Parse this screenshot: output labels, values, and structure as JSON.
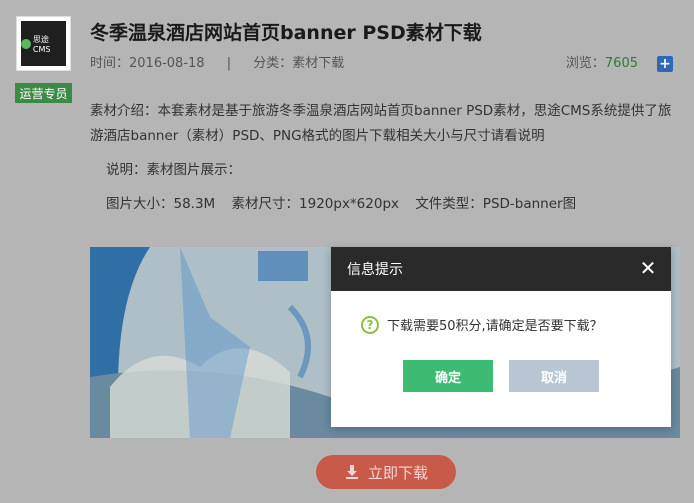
{
  "logo": {
    "text": "思途CMS"
  },
  "badge": {
    "label": "运营专员"
  },
  "article": {
    "title": "冬季温泉酒店网站首页banner PSD素材下载",
    "time_label": "时间：2016-08-18",
    "separator": "|",
    "category_label": "分类：素材下载",
    "views_label": "浏览：",
    "views_count": "7605",
    "description": "素材介绍：本套素材是基于旅游冬季温泉酒店网站首页banner PSD素材，思途CMS系统提供了旅游酒店banner（素材）PSD、PNG格式的图片下载相关大小与尺寸请看说明",
    "note": "说明：素材图片展示：",
    "size": "图片大小：58.3M",
    "dimensions": "素材尺寸：1920px*620px",
    "filetype": "文件类型：PSD-banner图"
  },
  "download": {
    "label": "立即下载"
  },
  "dialog": {
    "title": "信息提示",
    "message": "下载需要50积分,请确定是否要下载？",
    "ok_label": "确定",
    "cancel_label": "取消"
  },
  "colors": {
    "badge_green": "#3d8a47",
    "ok_green": "#3dbb73",
    "cancel_gray_blue": "#b9c6d4",
    "download_red": "#c85a4a",
    "dialog_header": "#2a2a2a"
  }
}
